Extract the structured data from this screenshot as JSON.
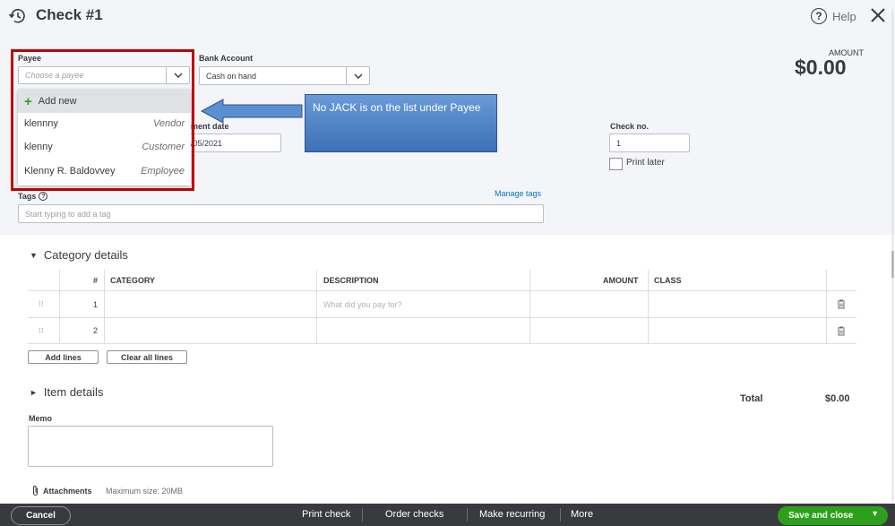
{
  "header": {
    "title": "Check #1",
    "help_label": "Help",
    "help_glyph": "?",
    "history_icon": "history-icon",
    "close_icon": "close-icon"
  },
  "payee": {
    "label": "Payee",
    "placeholder": "Choose a payee",
    "dropdown": {
      "add_new_label": "Add new",
      "items": [
        {
          "name": "klennny",
          "type": "Vendor"
        },
        {
          "name": "klenny",
          "type": "Customer"
        },
        {
          "name": "Klenny R. Baldovvey",
          "type": "Employee"
        }
      ]
    }
  },
  "bank_account": {
    "label": "Bank Account",
    "value": "Cash on hand"
  },
  "payment_date": {
    "label_visible": "ment date",
    "value_visible": "/05/2021"
  },
  "check_no": {
    "label": "Check no.",
    "value": "1",
    "print_later_label": "Print later"
  },
  "amount": {
    "label": "AMOUNT",
    "value": "$0.00"
  },
  "tags": {
    "label": "Tags",
    "info_glyph": "?",
    "placeholder": "Start typing to add a tag",
    "manage_label": "Manage tags"
  },
  "annotation": {
    "text": "No JACK is on the list under Payee",
    "fill_color": "#5b8fd0",
    "frame_color": "#c00000"
  },
  "category_details": {
    "title": "Category details",
    "toggle_glyph": "▼",
    "columns": [
      "#",
      "CATEGORY",
      "DESCRIPTION",
      "AMOUNT",
      "CLASS"
    ],
    "rows": [
      {
        "num": "1",
        "description_placeholder": "What did you pay for?"
      },
      {
        "num": "2",
        "description_placeholder": ""
      }
    ],
    "add_lines_label": "Add lines",
    "clear_lines_label": "Clear all lines"
  },
  "item_details": {
    "title": "Item details",
    "toggle_glyph": "►"
  },
  "total": {
    "label": "Total",
    "value": "$0.00"
  },
  "memo": {
    "label": "Memo"
  },
  "attachments": {
    "label": "Attachments",
    "max_size": "Maximum size: 20MB"
  },
  "footer": {
    "cancel_label": "Cancel",
    "links": [
      "Print check",
      "Order checks",
      "Make recurring",
      "More"
    ],
    "save_label": "Save and close",
    "save_caret": "▼",
    "accent_color": "#2ca01c",
    "bar_color": "#393a3d"
  }
}
